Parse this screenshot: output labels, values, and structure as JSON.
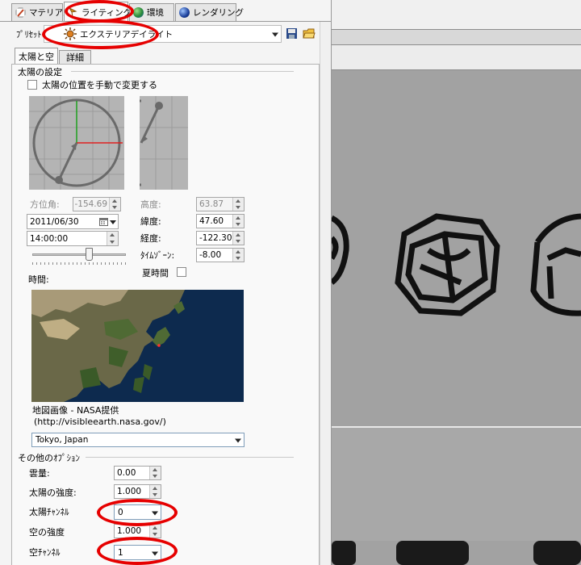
{
  "tabs": [
    {
      "label": "マテリアル",
      "icon": "material-icon"
    },
    {
      "label": "ライティング",
      "icon": "lighting-icon"
    },
    {
      "label": "環境",
      "icon": "environment-icon"
    },
    {
      "label": "レンダリング",
      "icon": "rendering-icon"
    }
  ],
  "preset": {
    "label": "ﾌﾟﾘｾｯﾄ",
    "value": "エクステリアデイライト"
  },
  "subtabs": [
    "太陽と空",
    "詳細"
  ],
  "sun": {
    "section_title": "太陽の設定",
    "manual_checkbox_label": "太陽の位置を手動で変更する",
    "azimuth_label": "方位角:",
    "azimuth_value": "-154.69",
    "altitude_label": "高度:",
    "altitude_value": "63.87",
    "date_value": "2011/06/30",
    "time_value": "14:00:00",
    "latitude_label": "緯度:",
    "latitude_value": "47.60",
    "longitude_label": "経度:",
    "longitude_value": "-122.30",
    "timezone_label": "ﾀｲﾑｿﾞｰﾝ:",
    "timezone_value": "-8.00",
    "dst_label": "夏時間",
    "time_label": "時間:",
    "time_slider_fraction": 0.5,
    "map_caption_line1": "地図画像 - NASA提供",
    "map_caption_line2": "(http://visibleearth.nasa.gov/)",
    "location_value": "Tokyo, Japan"
  },
  "other": {
    "section_title": "その他のｵﾌﾟｼｮﾝ",
    "cloud_label": "雲量:",
    "cloud_value": "0.00",
    "sun_intensity_label": "太陽の強度:",
    "sun_intensity_value": "1.000",
    "sun_channel_label": "太陽ﾁｬﾝﾈﾙ",
    "sun_channel_value": "0",
    "sky_intensity_label": "空の強度",
    "sky_intensity_value": "1.000",
    "sky_channel_label": "空ﾁｬﾝﾈﾙ",
    "sky_channel_value": "1"
  },
  "colors": {
    "highlight_ring": "#e60000",
    "accent": "#7f9db9"
  }
}
